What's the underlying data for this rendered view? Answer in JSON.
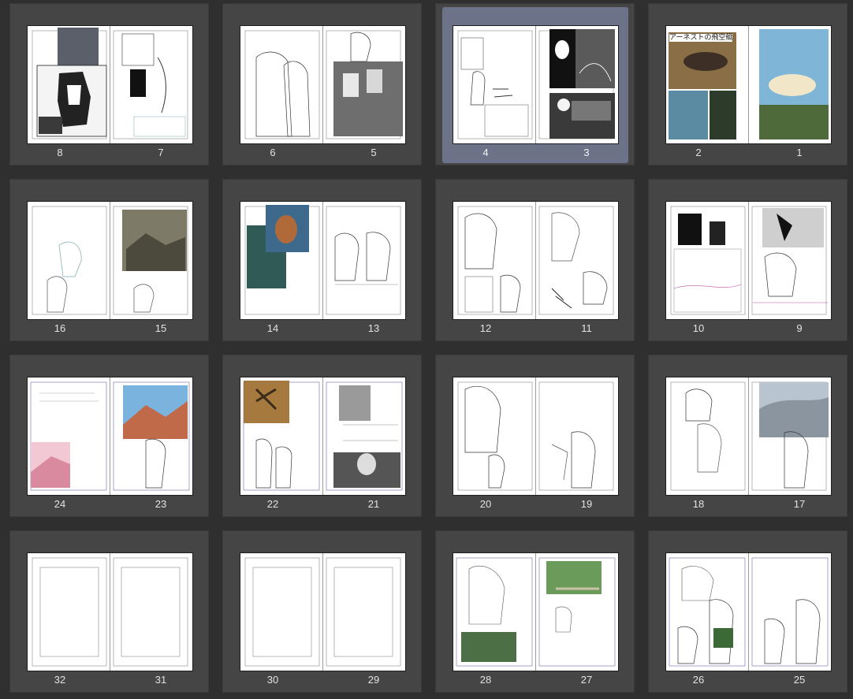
{
  "colors": {
    "background": "#2f2f2f",
    "cell": "#454545",
    "selected": "#6c7389",
    "page": "#ffffff"
  },
  "title_text": "アーネストの飛空艇",
  "spreads": [
    {
      "left": "8",
      "right": "7",
      "selected": false
    },
    {
      "left": "6",
      "right": "5",
      "selected": false
    },
    {
      "left": "4",
      "right": "3",
      "selected": true
    },
    {
      "left": "2",
      "right": "1",
      "selected": false
    },
    {
      "left": "16",
      "right": "15",
      "selected": false
    },
    {
      "left": "14",
      "right": "13",
      "selected": false
    },
    {
      "left": "12",
      "right": "11",
      "selected": false
    },
    {
      "left": "10",
      "right": "9",
      "selected": false
    },
    {
      "left": "24",
      "right": "23",
      "selected": false
    },
    {
      "left": "22",
      "right": "21",
      "selected": false
    },
    {
      "left": "20",
      "right": "19",
      "selected": false
    },
    {
      "left": "18",
      "right": "17",
      "selected": false
    },
    {
      "left": "32",
      "right": "31",
      "selected": false
    },
    {
      "left": "30",
      "right": "29",
      "selected": false
    },
    {
      "left": "28",
      "right": "27",
      "selected": false
    },
    {
      "left": "26",
      "right": "25",
      "selected": false
    }
  ]
}
